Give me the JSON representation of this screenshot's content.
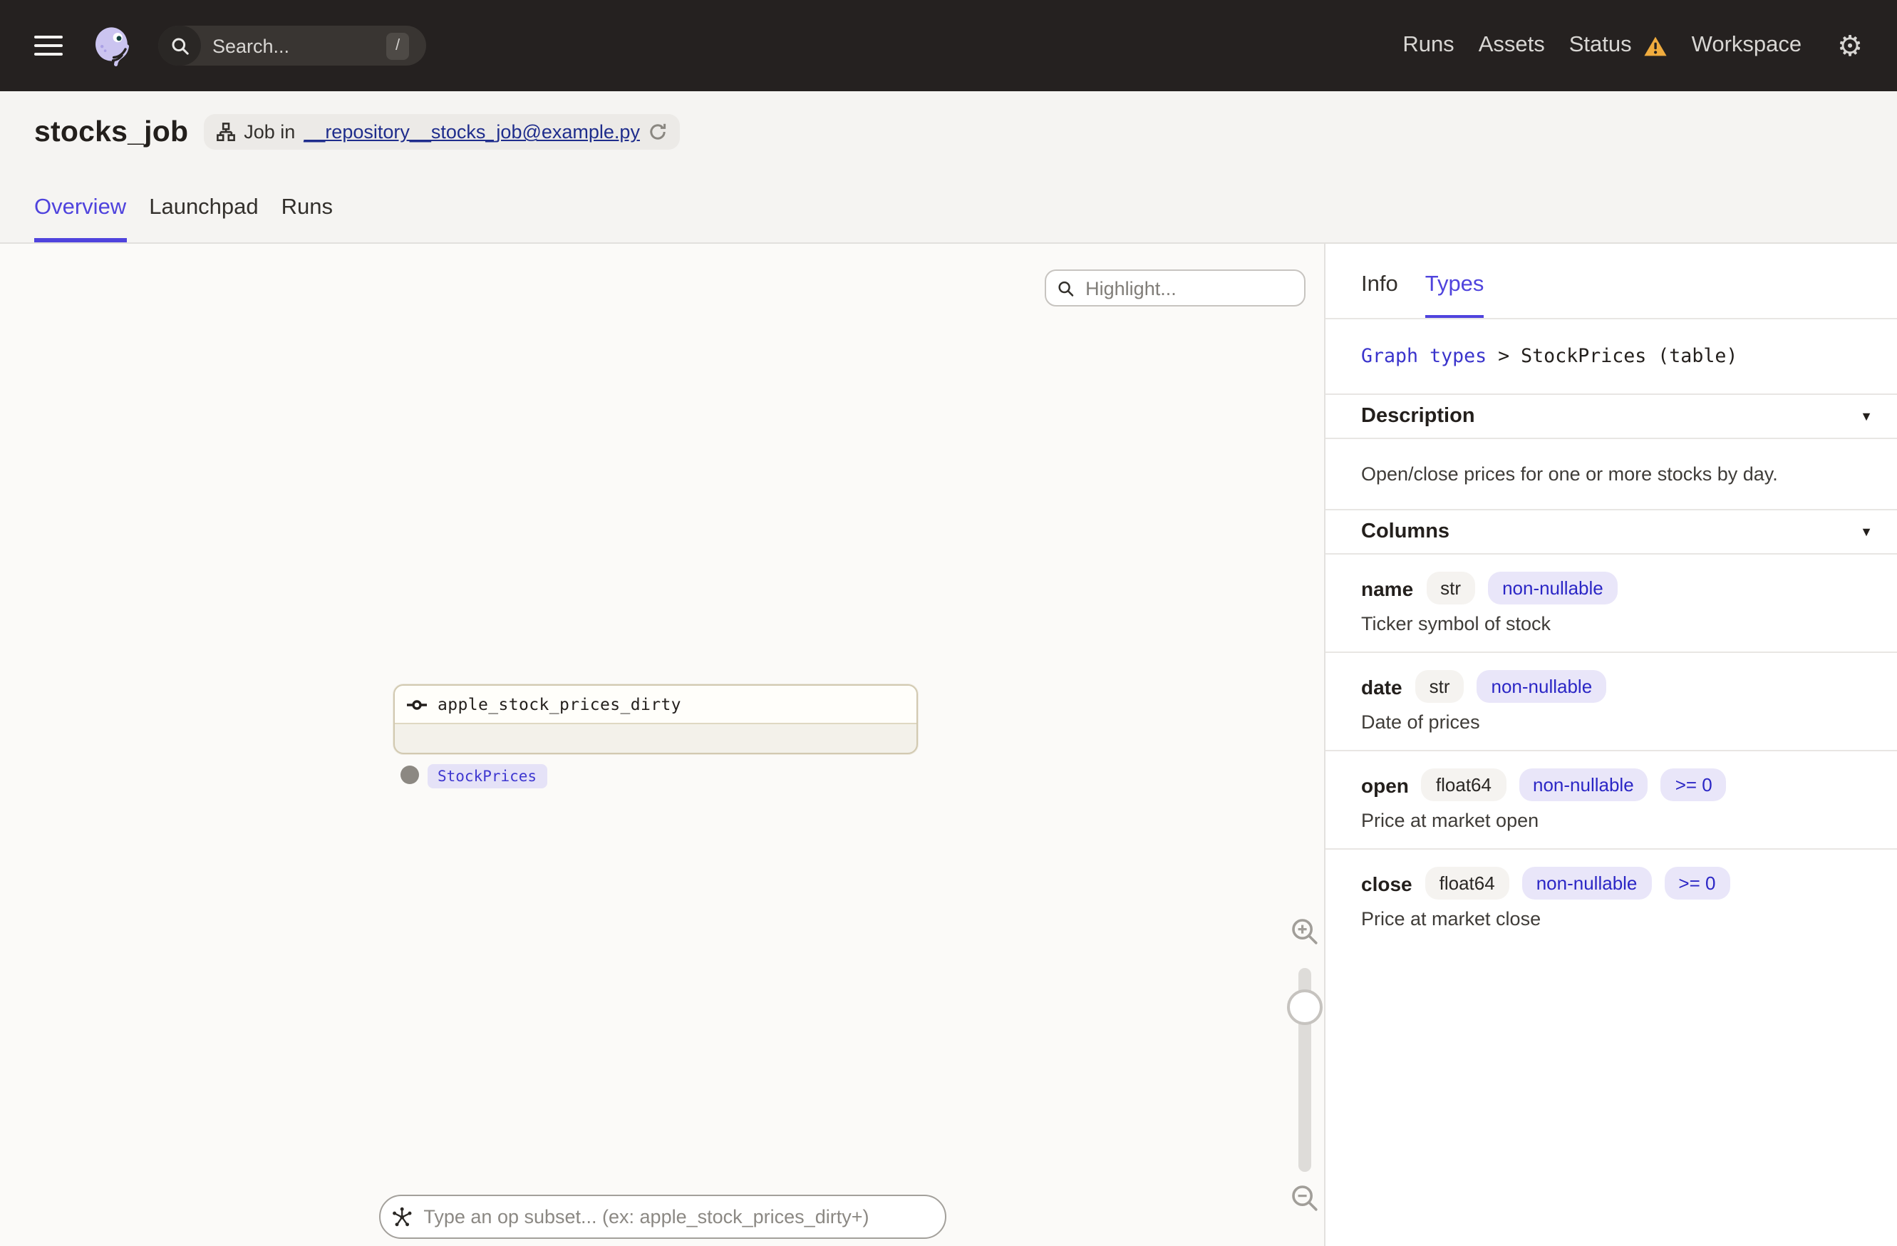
{
  "navbar": {
    "search_placeholder": "Search...",
    "search_shortcut": "/",
    "links": [
      {
        "label": "Runs"
      },
      {
        "label": "Assets"
      },
      {
        "label": "Status",
        "warning": true
      },
      {
        "label": "Workspace"
      }
    ],
    "icons": [
      "hamburger-icon",
      "dagster-logo",
      "search-icon",
      "warning-triangle-icon",
      "gear-icon"
    ]
  },
  "header": {
    "title": "stocks_job",
    "context_prefix": "Job in",
    "context_link": "__repository__stocks_job@example.py",
    "tabs": [
      {
        "label": "Overview",
        "active": true
      },
      {
        "label": "Launchpad",
        "active": false
      },
      {
        "label": "Runs",
        "active": false
      }
    ]
  },
  "canvas": {
    "highlight_placeholder": "Highlight...",
    "node": {
      "name": "apple_stock_prices_dirty",
      "output_type_tag": "StockPrices"
    },
    "op_subset_placeholder": "Type an op subset... (ex: apple_stock_prices_dirty+)"
  },
  "sidebar": {
    "tabs": [
      {
        "label": "Info",
        "active": false
      },
      {
        "label": "Types",
        "active": true
      }
    ],
    "breadcrumb": {
      "link": "Graph types",
      "separator": ">",
      "current": "StockPrices (table)"
    },
    "description": {
      "title": "Description",
      "content": "Open/close prices for one or more stocks by day."
    },
    "columns_title": "Columns",
    "columns": [
      {
        "name": "name",
        "type": "str",
        "tags": [
          "non-nullable"
        ],
        "description": "Ticker symbol of stock"
      },
      {
        "name": "date",
        "type": "str",
        "tags": [
          "non-nullable"
        ],
        "description": "Date of prices"
      },
      {
        "name": "open",
        "type": "float64",
        "tags": [
          "non-nullable",
          ">= 0"
        ],
        "description": "Price at market open"
      },
      {
        "name": "close",
        "type": "float64",
        "tags": [
          "non-nullable",
          ">= 0"
        ],
        "description": "Price at market close"
      }
    ]
  },
  "colors": {
    "accent": "#4F43DD",
    "warning": "#F0AC3E",
    "link_navy": "#1F2D8C",
    "chip_indigo_bg": "#E9E6F9",
    "chip_indigo_text": "#2B26C5",
    "navbar_bg": "#252120",
    "node_border": "#D2C9B1"
  }
}
